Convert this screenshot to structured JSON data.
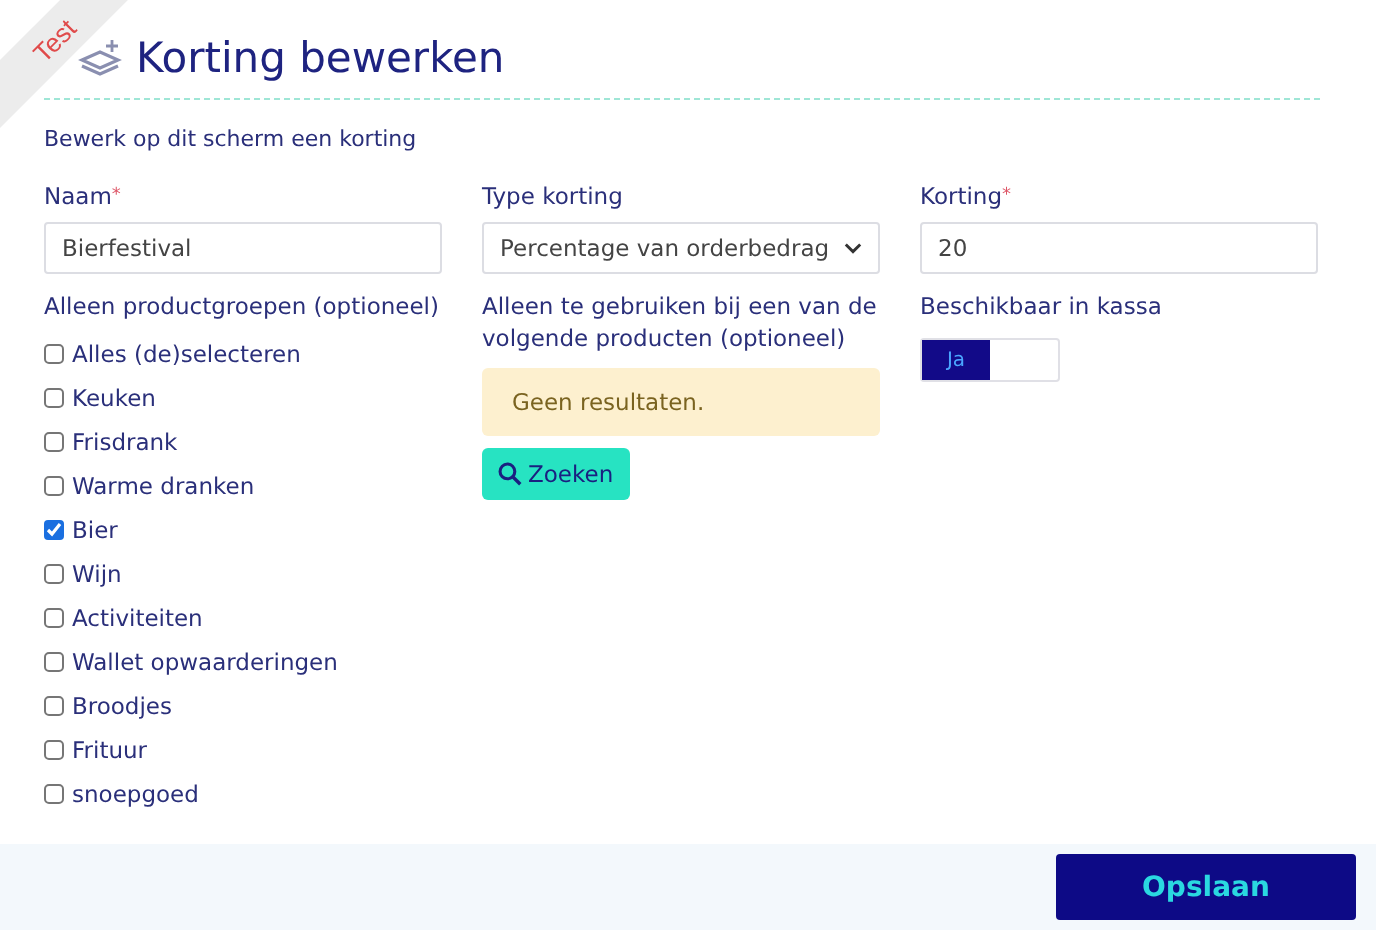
{
  "ribbon": {
    "label": "Test"
  },
  "title": "Korting bewerken",
  "subtitle": "Bewerk op dit scherm een korting",
  "name_field": {
    "label": "Naam",
    "required_mark": "*",
    "value": "Bierfestival"
  },
  "type_field": {
    "label": "Type korting",
    "value": "Percentage van orderbedrag"
  },
  "discount_field": {
    "label": "Korting",
    "required_mark": "*",
    "value": "20"
  },
  "groups": {
    "label": "Alleen productgroepen (optioneel)",
    "items": [
      {
        "label": "Alles (de)selecteren",
        "checked": false
      },
      {
        "label": "Keuken",
        "checked": false
      },
      {
        "label": "Frisdrank",
        "checked": false
      },
      {
        "label": "Warme dranken",
        "checked": false
      },
      {
        "label": "Bier",
        "checked": true
      },
      {
        "label": "Wijn",
        "checked": false
      },
      {
        "label": "Activiteiten",
        "checked": false
      },
      {
        "label": "Wallet opwaarderingen",
        "checked": false
      },
      {
        "label": "Broodjes",
        "checked": false
      },
      {
        "label": "Frituur",
        "checked": false
      },
      {
        "label": "snoepgoed",
        "checked": false
      }
    ]
  },
  "products": {
    "label": "Alleen te gebruiken bij een van de volgende producten (optioneel)",
    "notice": "Geen resultaten.",
    "search_button": "Zoeken"
  },
  "pos": {
    "label": "Beschikbaar in kassa",
    "toggle_label": "Ja",
    "on": true
  },
  "save_button": "Opslaan"
}
